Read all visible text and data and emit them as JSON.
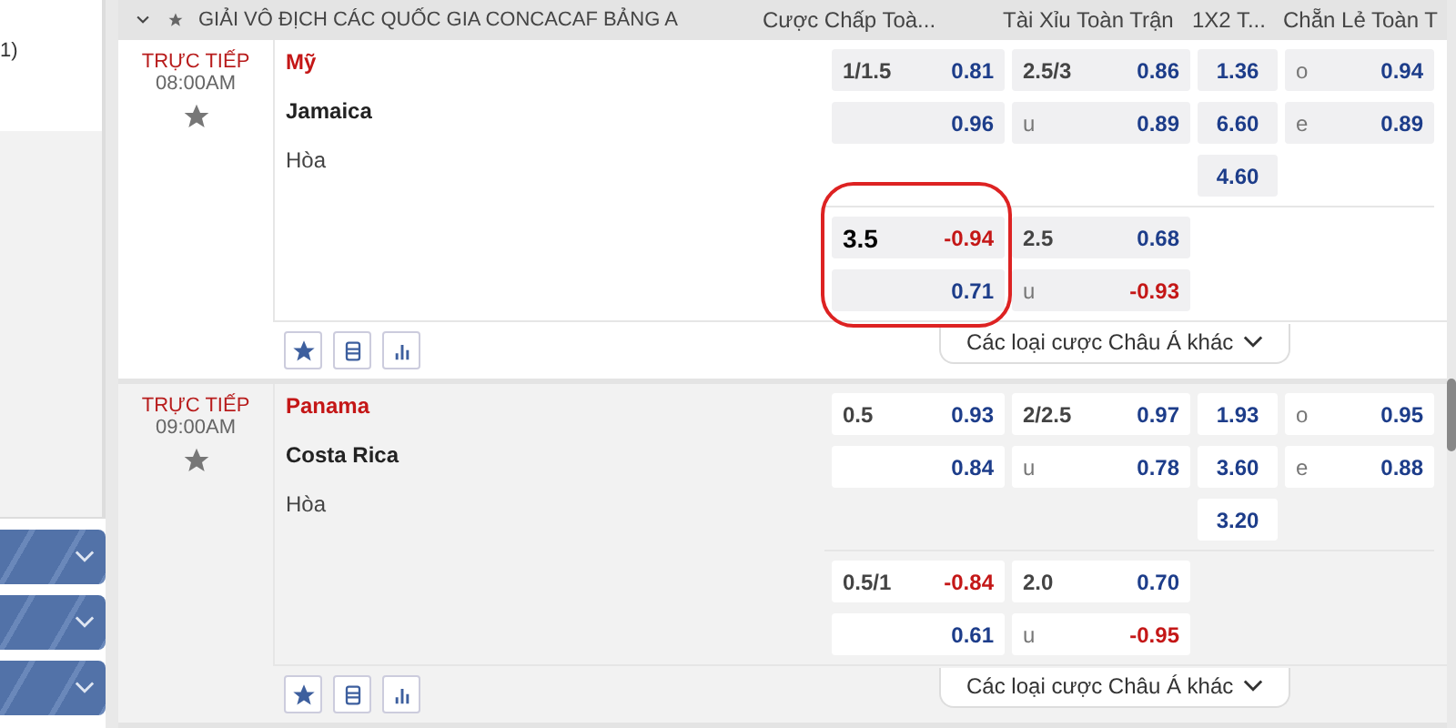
{
  "sidebar": {
    "texts": [
      "1)"
    ],
    "panels": [
      {
        "expanded": false
      },
      {
        "expanded": false
      },
      {
        "expanded": false
      }
    ]
  },
  "league": {
    "expanded": true,
    "title": "GIẢI VÔ ĐỊCH CÁC QUỐC GIA CONCACAF BẢNG A"
  },
  "columns": [
    "Cược Chấp Toà...",
    "Tài Xỉu Toàn Trận",
    "1X2 T...",
    "Chẵn Lẻ Toàn T"
  ],
  "matches": [
    {
      "status": "TRỰC TIẾP",
      "time": "08:00AM",
      "home": "Mỹ",
      "away": "Jamaica",
      "draw": "Hòa",
      "shaded": false,
      "more": "Các loại cược Châu Á khác",
      "lines": [
        {
          "highlighted": false,
          "hdp": [
            {
              "label": "1/1.5",
              "odd": "0.81",
              "negative": false
            },
            {
              "odd": "0.96",
              "negative": false
            }
          ],
          "ou": [
            {
              "label": "2.5/3",
              "odd": "0.86",
              "negative": false
            },
            {
              "label": "u",
              "odd": "0.89",
              "negative": false
            }
          ],
          "x12": [
            "1.36",
            "6.60",
            "4.60"
          ],
          "oe": [
            {
              "label": "o",
              "odd": "0.94"
            },
            {
              "label": "e",
              "odd": "0.89"
            }
          ]
        },
        {
          "highlighted": true,
          "hdp": [
            {
              "label": "3.5",
              "odd": "-0.94",
              "negative": true
            },
            {
              "odd": "0.71",
              "negative": false
            }
          ],
          "ou": [
            {
              "label": "2.5",
              "odd": "0.68",
              "negative": false
            },
            {
              "label": "u",
              "odd": "-0.93",
              "negative": true
            }
          ]
        }
      ]
    },
    {
      "status": "TRỰC TIẾP",
      "time": "09:00AM",
      "home": "Panama",
      "away": "Costa Rica",
      "draw": "Hòa",
      "shaded": true,
      "more": "Các loại cược Châu Á khác",
      "lines": [
        {
          "highlighted": false,
          "hdp": [
            {
              "label": "0.5",
              "odd": "0.93",
              "negative": false
            },
            {
              "odd": "0.84",
              "negative": false
            }
          ],
          "ou": [
            {
              "label": "2/2.5",
              "odd": "0.97",
              "negative": false
            },
            {
              "label": "u",
              "odd": "0.78",
              "negative": false
            }
          ],
          "x12": [
            "1.93",
            "3.60",
            "3.20"
          ],
          "oe": [
            {
              "label": "o",
              "odd": "0.95"
            },
            {
              "label": "e",
              "odd": "0.88"
            }
          ]
        },
        {
          "highlighted": false,
          "hdp": [
            {
              "label": "0.5/1",
              "odd": "-0.84",
              "negative": true
            },
            {
              "odd": "0.61",
              "negative": false
            }
          ],
          "ou": [
            {
              "label": "2.0",
              "odd": "0.70",
              "negative": false
            },
            {
              "label": "u",
              "odd": "-0.95",
              "negative": true
            }
          ]
        }
      ]
    }
  ]
}
